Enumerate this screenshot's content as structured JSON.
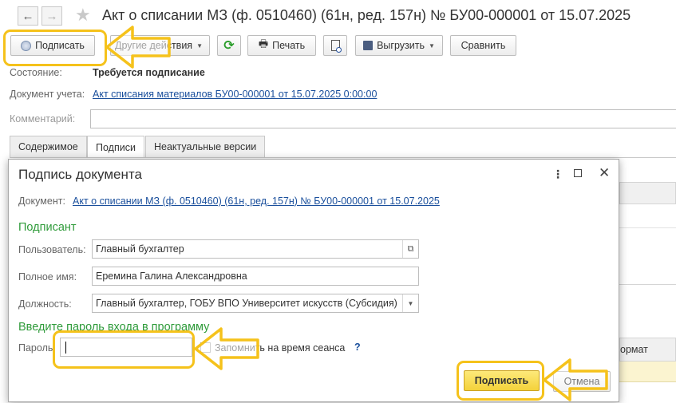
{
  "window": {
    "title": "Акт о списании МЗ (ф. 0510460) (61н, ред. 157н) № БУ00-000001 от 15.07.2025"
  },
  "nav": {
    "back_icon": "arrow-left-icon",
    "forward_icon": "arrow-right-icon",
    "favorite_icon": "star-icon"
  },
  "toolbar": {
    "sign_label": "Подписать",
    "other_actions_label": "Другие действия",
    "refresh_icon": "refresh-icon",
    "print_label": "Печать",
    "preview_icon": "preview-icon",
    "export_label": "Выгрузить",
    "compare_label": "Сравнить"
  },
  "form": {
    "state_label": "Состояние:",
    "state_value": "Требуется подписание",
    "account_doc_label": "Документ учета:",
    "account_doc_value": "Акт списания материалов БУ00-000001 от 15.07.2025 0:00:00",
    "comment_label": "Комментарий:",
    "comment_value": ""
  },
  "tabs": [
    {
      "label": "Содержимое"
    },
    {
      "label": "Подписи"
    },
    {
      "label": "Неактуальные версии"
    }
  ],
  "background_fragments": {
    "format_col_partial": "ормат"
  },
  "dialog": {
    "title": "Подпись документа",
    "document_label": "Документ:",
    "document_value": "Акт о списании МЗ (ф. 0510460) (61н, ред. 157н) № БУ00-000001 от 15.07.2025",
    "signer_section": "Подписант",
    "user_label": "Пользователь:",
    "user_value": "Главный бухгалтер",
    "fullname_label": "Полное имя:",
    "fullname_value": "Еремина Галина Александровна",
    "position_label": "Должность:",
    "position_value": "Главный бухгалтер, ГОБУ ВПО Университет искусств (Субсидия)",
    "password_section": "Введите пароль входа в программу",
    "password_label": "Пароль:",
    "password_value": "",
    "remember_label": "Запомнить на время сеанса",
    "help_label": "?",
    "sign_button": "Подписать",
    "cancel_button": "Отмена"
  },
  "colors": {
    "highlight": "#f5c21b",
    "accent_green": "#2f9b3a",
    "link": "#1a4f9c"
  }
}
